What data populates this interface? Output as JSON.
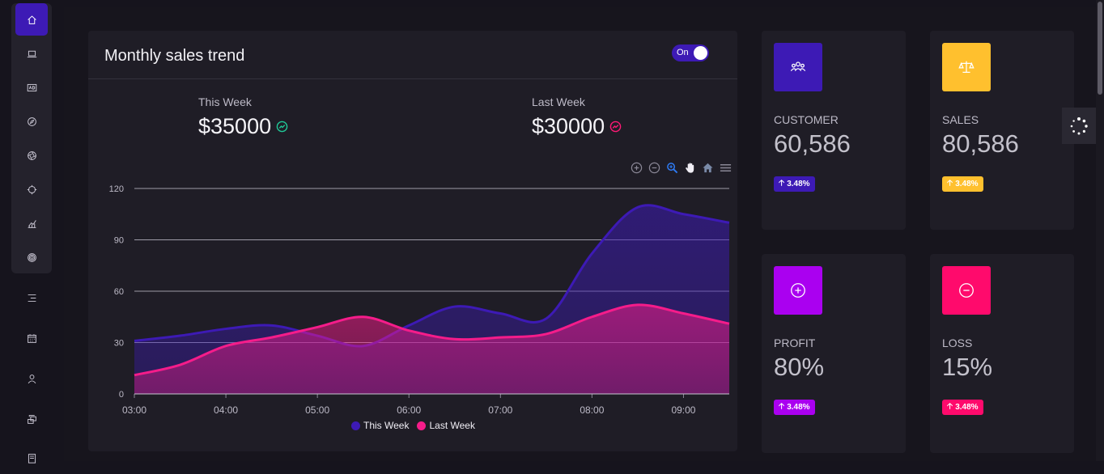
{
  "sidebar": {
    "group_icons": [
      "home-icon",
      "laptop-icon",
      "ad-icon",
      "compass-icon",
      "aperture-icon",
      "crosshair-icon",
      "chart-icon",
      "target-icon"
    ],
    "icons": [
      "menu-icon",
      "calendar-icon",
      "user-icon",
      "layers-icon",
      "document-icon"
    ]
  },
  "chart_card": {
    "title": "Monthly sales trend",
    "toggle_label": "On",
    "this_week": {
      "label": "This Week",
      "value": "$35000",
      "color": "#20c997"
    },
    "last_week": {
      "label": "Last Week",
      "value": "$30000",
      "color": "#ff1a75"
    },
    "toolbar": [
      "zoom-in-icon",
      "zoom-out-icon",
      "search-zoom-icon",
      "pan-hand-icon",
      "reset-home-icon",
      "menu-icon"
    ]
  },
  "chart_data": {
    "type": "area",
    "x": [
      "03:00",
      "03:30",
      "04:00",
      "04:30",
      "05:00",
      "05:30",
      "06:00",
      "06:30",
      "07:00",
      "07:30",
      "08:00",
      "08:30",
      "09:00",
      "09:30"
    ],
    "xticks": [
      "03:00",
      "04:00",
      "05:00",
      "06:00",
      "07:00",
      "08:00",
      "09:00"
    ],
    "yticks": [
      0,
      30,
      60,
      90,
      120
    ],
    "ylim": [
      0,
      120
    ],
    "series": [
      {
        "name": "This Week",
        "color": "#3d1ab5",
        "values": [
          31,
          34,
          38,
          40,
          34,
          28,
          40,
          51,
          47,
          44,
          82,
          109,
          105,
          100
        ]
      },
      {
        "name": "Last Week",
        "color": "#f51c8a",
        "values": [
          11,
          17,
          28,
          33,
          39,
          45,
          37,
          32,
          33,
          35,
          45,
          52,
          47,
          41
        ]
      }
    ],
    "legend": "bottom",
    "grid": true
  },
  "stats": [
    {
      "label": "CUSTOMER",
      "value": "60,586",
      "badge": "3.48%",
      "color": "#3d1ab5",
      "icon": "users-icon"
    },
    {
      "label": "SALES",
      "value": "80,586",
      "badge": "3.48%",
      "color": "#ffc02e",
      "icon": "scale-icon"
    },
    {
      "label": "PROFIT",
      "value": "80%",
      "badge": "3.48%",
      "color": "#aa00f0",
      "icon": "plus-circle-icon"
    },
    {
      "label": "LOSS",
      "value": "15%",
      "badge": "3.48%",
      "color": "#ff0a6c",
      "icon": "minus-circle-icon"
    }
  ]
}
